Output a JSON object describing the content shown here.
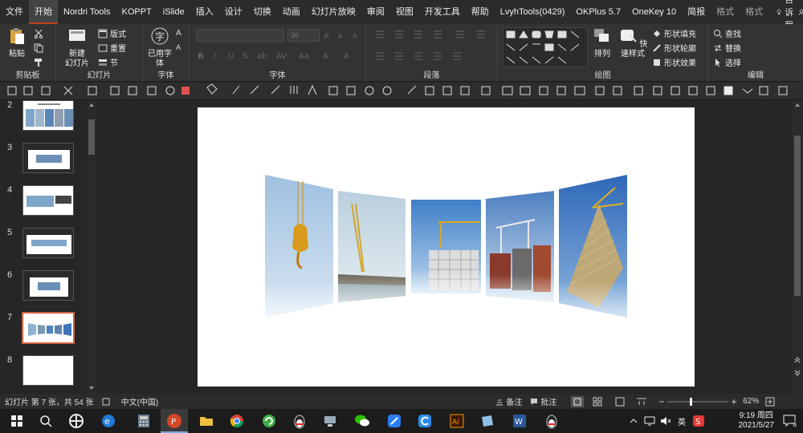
{
  "menu": {
    "tabs": [
      {
        "label": "文件"
      },
      {
        "label": "开始"
      },
      {
        "label": "Nordri Tools"
      },
      {
        "label": "KOPPT"
      },
      {
        "label": "iSlide"
      },
      {
        "label": "插入"
      },
      {
        "label": "设计"
      },
      {
        "label": "切换"
      },
      {
        "label": "动画"
      },
      {
        "label": "幻灯片放映"
      },
      {
        "label": "审阅"
      },
      {
        "label": "视图"
      },
      {
        "label": "开发工具"
      },
      {
        "label": "帮助"
      },
      {
        "label": "LvyhTools(0429)"
      },
      {
        "label": "OKPlus 5.7"
      },
      {
        "label": "OneKey 10"
      },
      {
        "label": "简报"
      },
      {
        "label": "格式"
      },
      {
        "label": "格式"
      }
    ],
    "tell_me": "告诉我",
    "share": "共享"
  },
  "ribbon": {
    "clipboard": {
      "group": "剪贴板",
      "paste": "粘贴"
    },
    "slides": {
      "group": "幻灯片",
      "new_slide_1": "新建",
      "new_slide_2": "幻灯片",
      "layout": "版式",
      "reset": "重置",
      "section": "节"
    },
    "font_used": {
      "group": "字体",
      "label_1": "已用字",
      "label_2": "体"
    },
    "font": {
      "group": "字体",
      "size": "36"
    },
    "paragraph": {
      "group": "段落"
    },
    "drawing": {
      "group": "绘图",
      "arrange": "排列",
      "quick_styles": "快速样式",
      "shape_fill": "形状填充",
      "shape_outline": "形状轮廓",
      "shape_effects": "形状效果"
    },
    "editing": {
      "group": "编辑",
      "find": "查找",
      "replace": "替换",
      "select": "选择"
    }
  },
  "slides_panel": {
    "items": [
      {
        "num": "2"
      },
      {
        "num": "3"
      },
      {
        "num": "4"
      },
      {
        "num": "5"
      },
      {
        "num": "6"
      },
      {
        "num": "7"
      },
      {
        "num": "8"
      }
    ],
    "selected": "7"
  },
  "statusbar": {
    "slide_info": "幻灯片 第 7 张，共 54 张",
    "language": "中文(中国)",
    "notes": "备注",
    "comments": "批注",
    "zoom": "62%"
  },
  "taskbar": {
    "ime": "英",
    "time": "9:19 周四",
    "date": "2021/5/27",
    "notification_count": "6"
  },
  "colors": {
    "accent": "#c43e1c",
    "selected_thumb": "#d26042"
  }
}
